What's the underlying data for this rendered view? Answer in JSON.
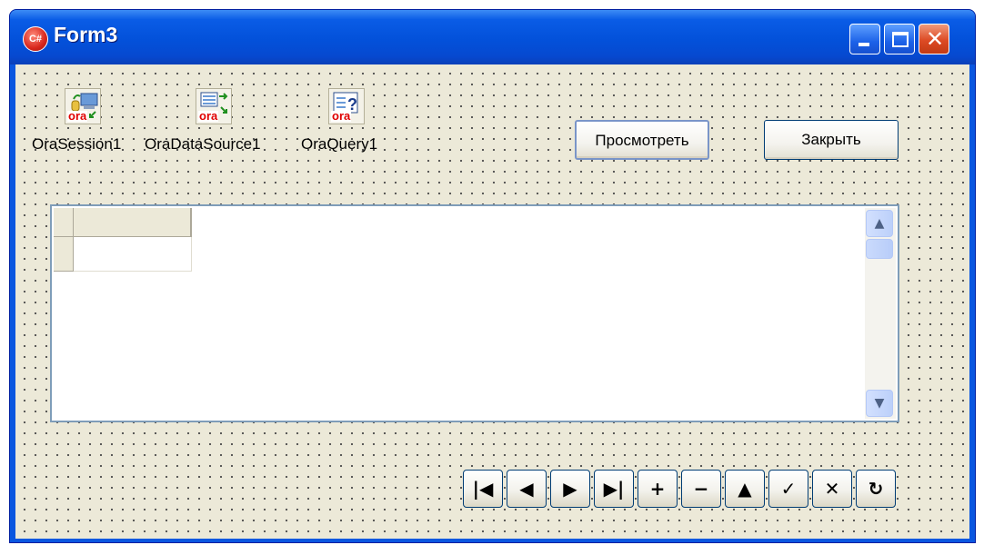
{
  "window": {
    "title": "Form3",
    "app_icon": "C#",
    "controls": {
      "minimize_icon": "minimize-icon",
      "maximize_icon": "maximize-icon",
      "close_icon": "close-icon",
      "close_glyph": "✕"
    },
    "colors": {
      "title_bar": "#0351da",
      "form_background": "#ece9d8",
      "close_button": "#dd4a24",
      "ora_text": "#e00000"
    }
  },
  "components": [
    {
      "label": "OraSession1",
      "badge": "ora",
      "icon": "ora-session-icon"
    },
    {
      "label": "OraDataSource1",
      "badge": "ora",
      "icon": "ora-datasource-icon"
    },
    {
      "label": "OraQuery1",
      "badge": "ora",
      "icon": "ora-query-icon"
    }
  ],
  "buttons": {
    "view": "Просмотреть",
    "close": "Закрыть"
  },
  "grid": {
    "columns": [
      ""
    ],
    "rows": [
      [
        ""
      ]
    ],
    "scroll": {
      "up_glyph": "▲",
      "down_glyph": "▼"
    }
  },
  "navigator": {
    "buttons": [
      {
        "name": "first",
        "glyph": "|◀"
      },
      {
        "name": "prior",
        "glyph": "◀"
      },
      {
        "name": "next",
        "glyph": "▶"
      },
      {
        "name": "last",
        "glyph": "▶|"
      },
      {
        "name": "insert",
        "glyph": "+"
      },
      {
        "name": "delete",
        "glyph": "−"
      },
      {
        "name": "edit",
        "glyph": "▲"
      },
      {
        "name": "post",
        "glyph": "✓"
      },
      {
        "name": "cancel",
        "glyph": "✕"
      },
      {
        "name": "refresh",
        "glyph": "↻"
      }
    ]
  }
}
